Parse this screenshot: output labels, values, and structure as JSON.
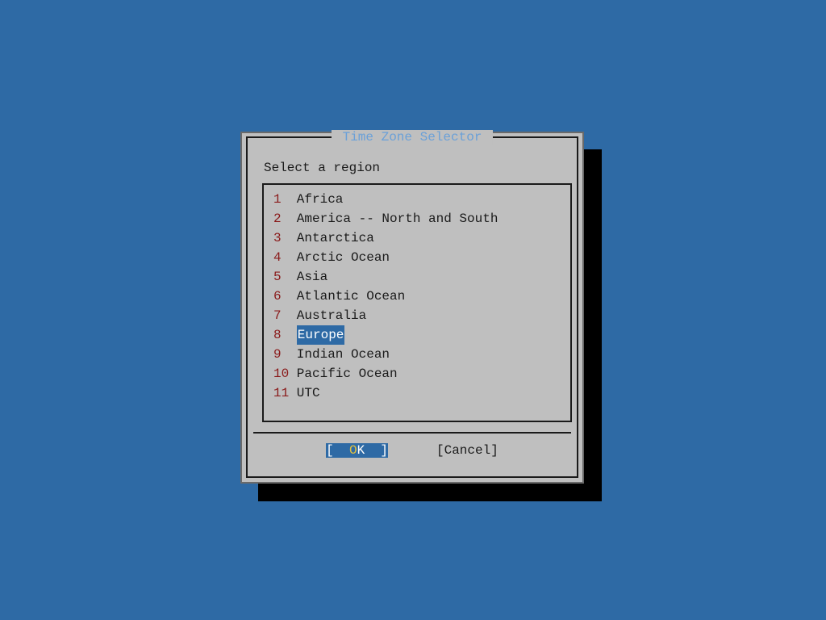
{
  "dialog": {
    "title": " Time Zone Selector ",
    "prompt": "Select a region",
    "selected_index": 7,
    "items": [
      {
        "num": "1 ",
        "label": "Africa"
      },
      {
        "num": "2 ",
        "label": "America -- North and South"
      },
      {
        "num": "3 ",
        "label": "Antarctica"
      },
      {
        "num": "4 ",
        "label": "Arctic Ocean"
      },
      {
        "num": "5 ",
        "label": "Asia"
      },
      {
        "num": "6 ",
        "label": "Atlantic Ocean"
      },
      {
        "num": "7 ",
        "label": "Australia"
      },
      {
        "num": "8 ",
        "label": "Europe"
      },
      {
        "num": "9 ",
        "label": "Indian Ocean"
      },
      {
        "num": "10",
        "label": "Pacific Ocean"
      },
      {
        "num": "11",
        "label": "UTC"
      }
    ],
    "buttons": {
      "ok_pre": "[  ",
      "ok_hot": "O",
      "ok_post": "K  ]",
      "cancel": "[Cancel]"
    }
  }
}
